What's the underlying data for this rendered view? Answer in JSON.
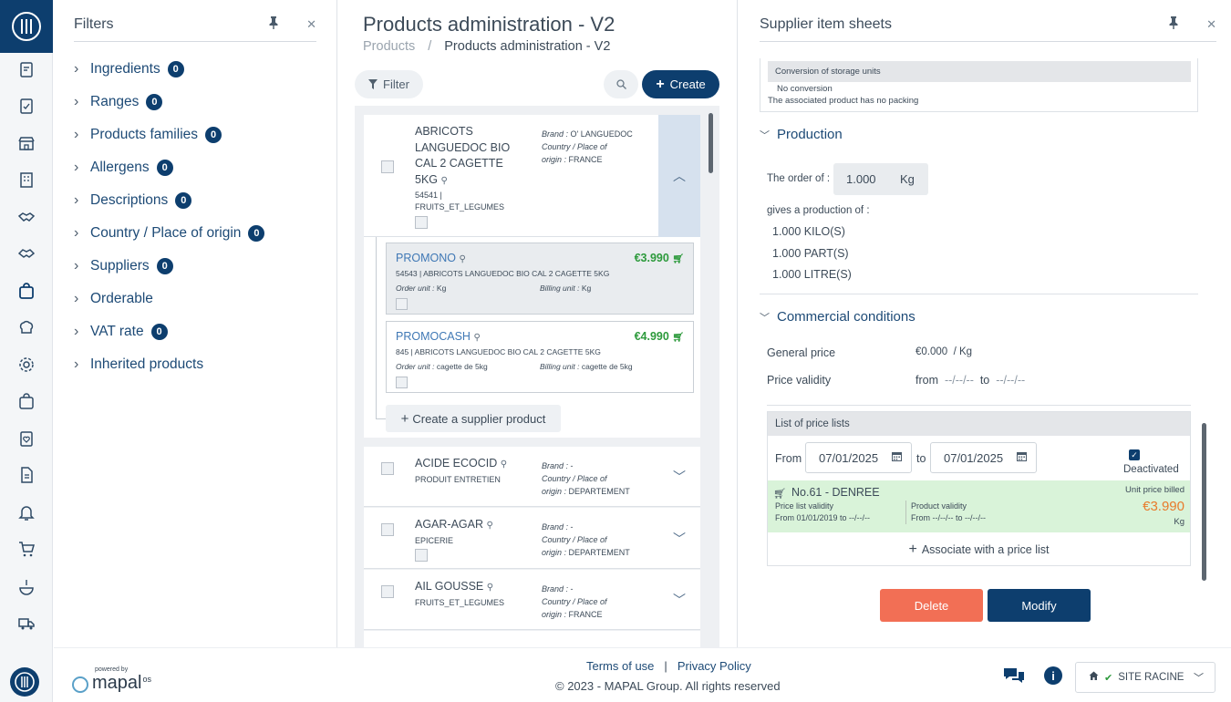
{
  "rail": {
    "icons": [
      "clipboard-edit-icon",
      "clipboard-check-icon",
      "store-icon",
      "building-icon",
      "handshake-icon",
      "handshake-alt-icon",
      "shopping-bag-icon",
      "chef-hat-icon",
      "gear-icon",
      "bag-icon",
      "clipboard-heart-icon",
      "document-icon",
      "bell-icon",
      "cart-icon",
      "dish-icon",
      "truck-icon"
    ]
  },
  "filters": {
    "title": "Filters",
    "items": [
      {
        "label": "Ingredients",
        "count": "0"
      },
      {
        "label": "Ranges",
        "count": "0"
      },
      {
        "label": "Products families",
        "count": "0"
      },
      {
        "label": "Allergens",
        "count": "0"
      },
      {
        "label": "Descriptions",
        "count": "0"
      },
      {
        "label": "Country / Place of origin",
        "count": "0"
      },
      {
        "label": "Suppliers",
        "count": "0"
      },
      {
        "label": "Orderable",
        "count": ""
      },
      {
        "label": "VAT rate",
        "count": "0"
      },
      {
        "label": "Inherited products",
        "count": ""
      }
    ]
  },
  "products": {
    "title": "Products administration - V2",
    "breadcrumb": {
      "root": "Products",
      "sep": "/",
      "current": "Products administration - V2"
    },
    "filter_label": "Filter",
    "create_label": "Create",
    "cards": [
      {
        "name_lines": [
          "ABRICOTS",
          "LANGUEDOC BIO",
          "CAL 2 CAGETTE",
          "5KG"
        ],
        "code": "54541 |",
        "family": "FRUITS_ET_LEGUMES",
        "brand_label": "Brand :",
        "brand": "O' LANGUEDOC",
        "origin_label1": "Country / Place of",
        "origin_label2": "origin :",
        "origin": "FRANCE"
      },
      {
        "name": "ACIDE ECOCID",
        "family": "PRODUIT ENTRETIEN",
        "brand_label": "Brand :",
        "brand": "-",
        "origin_label1": "Country / Place of",
        "origin_label2": "origin :",
        "origin": "DEPARTEMENT"
      },
      {
        "name": "AGAR-AGAR",
        "family": "EPICERIE",
        "brand_label": "Brand :",
        "brand": "-",
        "origin_label1": "Country / Place of",
        "origin_label2": "origin :",
        "origin": "DEPARTEMENT"
      },
      {
        "name": "AIL GOUSSE",
        "family": "FRUITS_ET_LEGUMES",
        "brand_label": "Brand :",
        "brand": "-",
        "origin_label1": "Country / Place of",
        "origin_label2": "origin :",
        "origin": "FRANCE"
      }
    ],
    "supplier_products": [
      {
        "name": "PROMONO",
        "price": "€3.990",
        "desc": "54543 | ABRICOTS LANGUEDOC BIO CAL 2 CAGETTE 5KG",
        "order_unit_label": "Order unit :",
        "order_unit": "Kg",
        "billing_unit_label": "Billing unit :",
        "billing_unit": "Kg"
      },
      {
        "name": "PROMOCASH",
        "price": "€4.990",
        "desc": "845 | ABRICOTS LANGUEDOC BIO CAL 2 CAGETTE 5KG",
        "order_unit_label": "Order unit :",
        "order_unit": "cagette de 5kg",
        "billing_unit_label": "Billing unit :",
        "billing_unit": "cagette de 5kg"
      }
    ],
    "create_supplier_label": "Create a supplier product"
  },
  "sheets": {
    "title": "Supplier item sheets",
    "conversion": {
      "head": "Conversion of storage units",
      "line1": "No conversion",
      "line2": "The associated product has no packing"
    },
    "production": {
      "title": "Production",
      "order_label": "The order of :",
      "order_value": "1.000",
      "order_unit": "Kg",
      "gives_label": "gives a production of :",
      "outputs": [
        "1.000 KILO(S)",
        "1.000 PART(S)",
        "1.000 LITRE(S)"
      ]
    },
    "commercial": {
      "title": "Commercial conditions",
      "general_price_label": "General price",
      "general_price": "€0.000",
      "general_price_unit": "/ Kg",
      "validity_label": "Price validity",
      "validity_from": "from",
      "validity_from_value": "--/--/--",
      "validity_to": "to",
      "validity_to_value": "--/--/--"
    },
    "price_lists": {
      "head": "List of price lists",
      "from_label": "From",
      "from_date": "07/01/2025",
      "to_label": "to",
      "to_date": "07/01/2025",
      "deactivated_label": "Deactivated",
      "row": {
        "name": "No.61 - DENREE",
        "unit_price_label": "Unit price billed",
        "price": "€3.990",
        "unit": "Kg",
        "pl_validity_label": "Price list validity",
        "pl_validity_value": "From 01/01/2019 to --/--/--",
        "prod_validity_label": "Product validity",
        "prod_validity_value": "From --/--/-- to --/--/--"
      },
      "associate_label": "Associate with a price list"
    },
    "delete_label": "Delete",
    "modify_label": "Modify"
  },
  "footer": {
    "powered_by": "powered by",
    "brand": "mapal",
    "brand_suffix": "os",
    "terms": "Terms of use",
    "sep": "|",
    "privacy": "Privacy Policy",
    "copyright": "© 2023 - MAPAL Group. All rights reserved",
    "site": "SITE RACINE"
  },
  "colors": {
    "primary": "#0d3e6e",
    "accent_green": "#2d9a3c",
    "price_orange": "#e87b2c",
    "delete_red": "#f26f55",
    "link_blue": "#3f78b5"
  }
}
